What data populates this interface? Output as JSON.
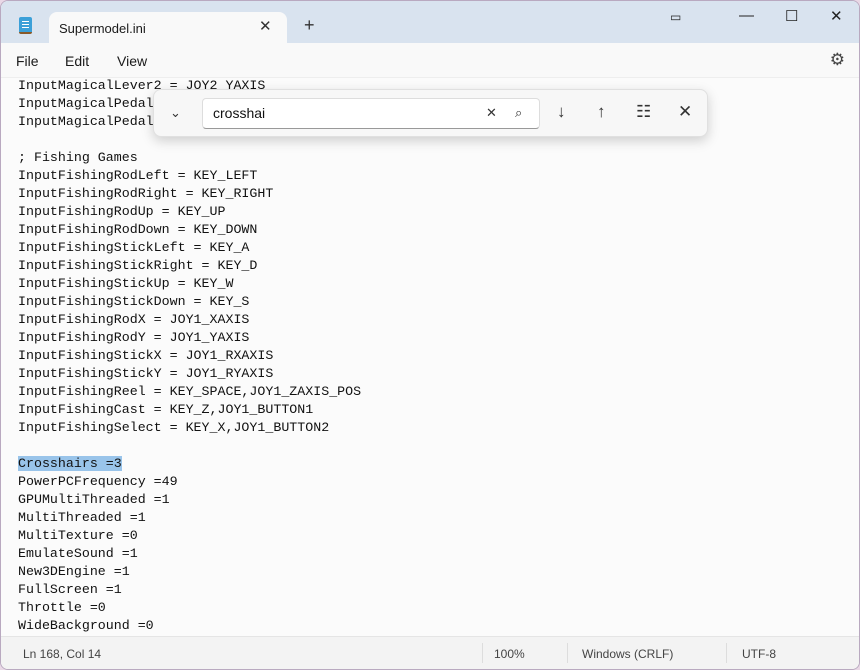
{
  "window": {
    "tab_title": "Supermodel.ini",
    "new_tab": "+"
  },
  "menu": {
    "file": "File",
    "edit": "Edit",
    "view": "View"
  },
  "editor": {
    "lines": [
      "InputMagicalLever2 = JOY2_YAXIS",
      "InputMagicalPedal",
      "InputMagicalPedal",
      "",
      "; Fishing Games",
      "InputFishingRodLeft = KEY_LEFT",
      "InputFishingRodRight = KEY_RIGHT",
      "InputFishingRodUp = KEY_UP",
      "InputFishingRodDown = KEY_DOWN",
      "InputFishingStickLeft = KEY_A",
      "InputFishingStickRight = KEY_D",
      "InputFishingStickUp = KEY_W",
      "InputFishingStickDown = KEY_S",
      "InputFishingRodX = JOY1_XAXIS",
      "InputFishingRodY = JOY1_YAXIS",
      "InputFishingStickX = JOY1_RXAXIS",
      "InputFishingStickY = JOY1_RYAXIS",
      "InputFishingReel = KEY_SPACE,JOY1_ZAXIS_POS",
      "InputFishingCast = KEY_Z,JOY1_BUTTON1",
      "InputFishingSelect = KEY_X,JOY1_BUTTON2",
      "",
      "Crosshairs =3",
      "PowerPCFrequency =49",
      "GPUMultiThreaded =1",
      "MultiThreaded =1",
      "MultiTexture =0",
      "EmulateSound =1",
      "New3DEngine =1",
      "FullScreen =1",
      "Throttle =0",
      "WideBackground =0"
    ],
    "selected_line": 21,
    "selection_color": "#99c4ea"
  },
  "find": {
    "query": "crosshai"
  },
  "status": {
    "position": "Ln 168, Col 14",
    "zoom": "100%",
    "line_ending": "Windows (CRLF)",
    "encoding": "UTF-8"
  }
}
